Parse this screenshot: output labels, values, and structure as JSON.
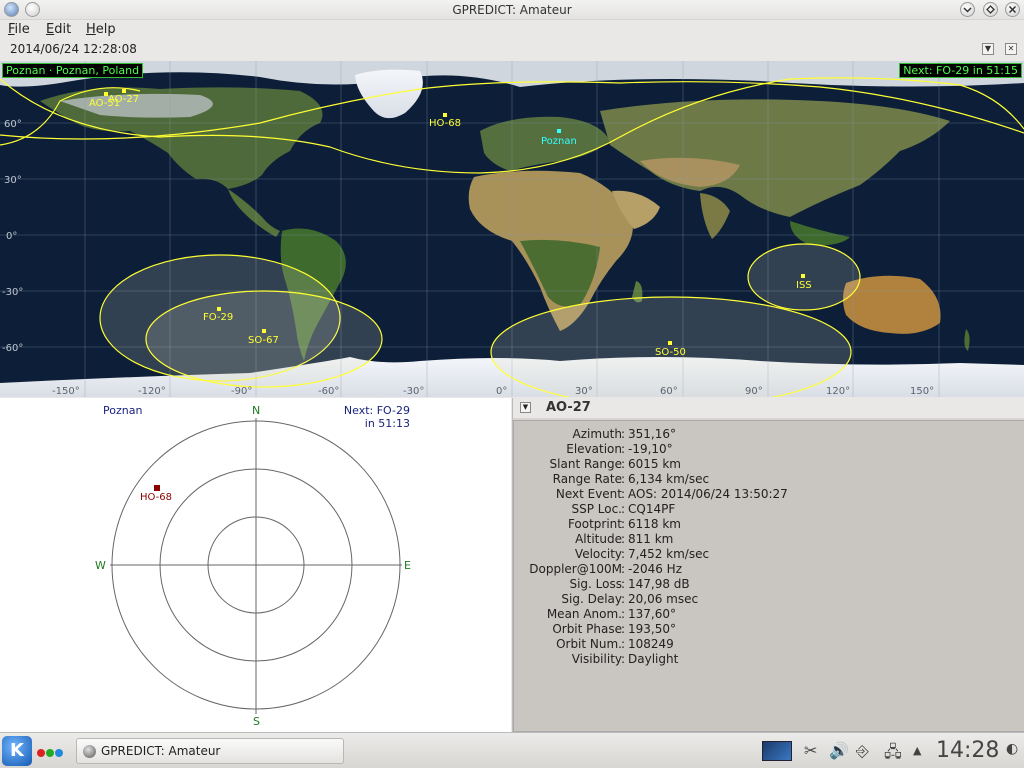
{
  "window": {
    "title": "GPREDICT: Amateur"
  },
  "menu": [
    {
      "first": "F",
      "rest": "ile"
    },
    {
      "first": "E",
      "rest": "dit"
    },
    {
      "first": "H",
      "rest": "elp"
    }
  ],
  "clock_time": "2014/06/24 12:28:08",
  "map": {
    "location_label": "Poznan · Poznan, Poland",
    "next_label": "Next: FO-29 in 51:15",
    "lat_labels": [
      "60°",
      "30°",
      "0°",
      "-30°",
      "-60°"
    ],
    "lon_labels": [
      "-150°",
      "-120°",
      "-90°",
      "-60°",
      "-30°",
      "0°",
      "30°",
      "60°",
      "90°",
      "120°",
      "150°"
    ],
    "qth": "Poznan",
    "satellites": [
      "AO-51",
      "AO-27",
      "HO-68",
      "FO-29",
      "SO-67",
      "SO-50",
      "ISS"
    ],
    "colors": {
      "sat": "#ffff33",
      "qth": "#33ffff"
    }
  },
  "polar": {
    "location": "Poznan",
    "next_line1": "Next: FO-29",
    "next_line2": "in 51:13",
    "compass": {
      "n": "N",
      "s": "S",
      "e": "E",
      "w": "W"
    },
    "sat": "HO-68"
  },
  "info": {
    "satellite": "AO-27",
    "rows": [
      {
        "label": "Azimuth",
        "value": "351,16°"
      },
      {
        "label": "Elevation",
        "value": "-19,10°"
      },
      {
        "label": "Slant Range",
        "value": "6015 km"
      },
      {
        "label": "Range Rate",
        "value": "6,134 km/sec"
      },
      {
        "label": "Next Event",
        "value": "AOS: 2014/06/24 13:50:27"
      },
      {
        "label": "SSP Loc.",
        "value": "CQ14PF"
      },
      {
        "label": "Footprint",
        "value": "6118 km"
      },
      {
        "label": "Altitude",
        "value": "811 km"
      },
      {
        "label": "Velocity",
        "value": "7,452 km/sec"
      },
      {
        "label": "Doppler@100M",
        "value": "-2046 Hz"
      },
      {
        "label": "Sig. Loss",
        "value": "147,98 dB"
      },
      {
        "label": "Sig. Delay",
        "value": "20,06 msec"
      },
      {
        "label": "Mean Anom.",
        "value": "137,60°"
      },
      {
        "label": "Orbit Phase",
        "value": "193,50°"
      },
      {
        "label": "Orbit Num.",
        "value": "108249"
      },
      {
        "label": "Visibility",
        "value": "Daylight"
      }
    ]
  },
  "taskbar": {
    "task_label": "GPREDICT: Amateur",
    "clock": "14:28"
  }
}
